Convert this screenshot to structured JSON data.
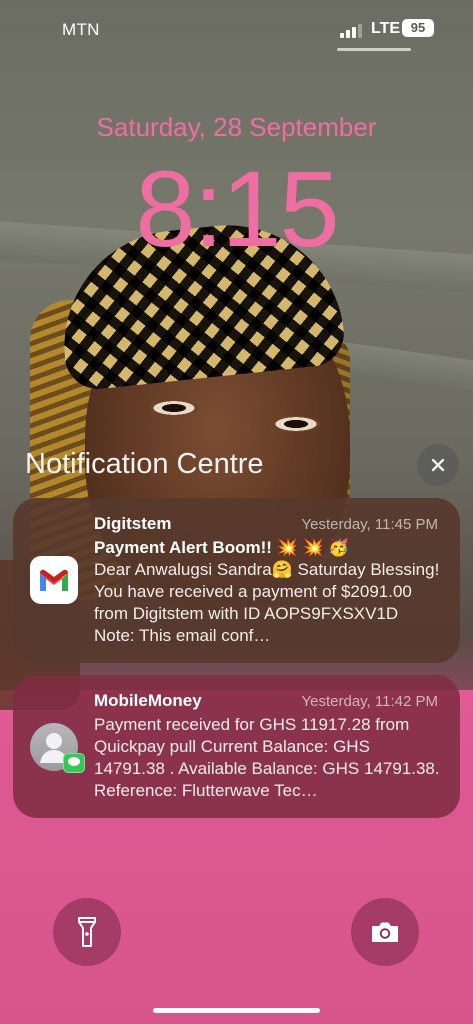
{
  "status_bar": {
    "carrier": "MTN",
    "network": "LTE",
    "battery": "95",
    "signal_icon": "signal-bars-icon"
  },
  "lock_screen": {
    "date": "Saturday, 28 September",
    "time": "8:15"
  },
  "notification_centre": {
    "title": "Notification Centre",
    "close_icon": "close-icon"
  },
  "notifications": [
    {
      "app": "Digitstem",
      "timestamp": "Yesterday, 11:45 PM",
      "subject": "Payment Alert Boom!! 💥 💥 🥳",
      "body": "Dear Anwalugsi Sandra🤗 Saturday Blessing! You have received a payment of $2091.00 from Digitstem with ID AOPS9FXSXV1D Note: This email conf…",
      "icon": "gmail-icon"
    },
    {
      "app": "MobileMoney",
      "timestamp": "Yesterday, 11:42 PM",
      "body": "Payment received for GHS 11917.28 from Quickpay pull  Current Balance: GHS 14791.38 . Available Balance: GHS 14791.38. Reference: Flutterwave Tec…",
      "icon": "contact-avatar-icon"
    }
  ],
  "quick_actions": {
    "left_icon": "flashlight-icon",
    "right_icon": "camera-icon"
  },
  "colors": {
    "clock_pink": "#ef6ea2",
    "gmail_card": "#56382c",
    "momo_card": "#802c42",
    "imessage_green": "#36c759"
  }
}
